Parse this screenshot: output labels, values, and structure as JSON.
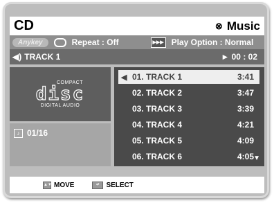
{
  "header": {
    "title": "CD",
    "mode_label": "Music",
    "mode_icon": "x-circle-icon"
  },
  "options": {
    "anykey_label": "Anykey",
    "repeat_label": "Repeat : Off",
    "play_option_label": "Play Option : Normal"
  },
  "status": {
    "track_label": "TRACK 1",
    "elapsed": "► 00 : 02"
  },
  "disc": {
    "compact": "COMPACT",
    "disc": "disc",
    "digital_audio": "DIGITAL AUDIO"
  },
  "counter": {
    "value": "01/16"
  },
  "tracks": [
    {
      "name": "01. TRACK 1",
      "time": "3:41"
    },
    {
      "name": "02. TRACK 2",
      "time": "3:47"
    },
    {
      "name": "03. TRACK 3",
      "time": "3:39"
    },
    {
      "name": "04. TRACK 4",
      "time": "4:21"
    },
    {
      "name": "05. TRACK 5",
      "time": "4:09"
    },
    {
      "name": "06. TRACK 6",
      "time": "4:05"
    }
  ],
  "footer": {
    "move_label": "MOVE",
    "select_label": "SELECT"
  },
  "colors": {
    "frame": "#bdbdbd",
    "selected_row": "#eeeeee",
    "list_bg": "#4a4a4a"
  }
}
